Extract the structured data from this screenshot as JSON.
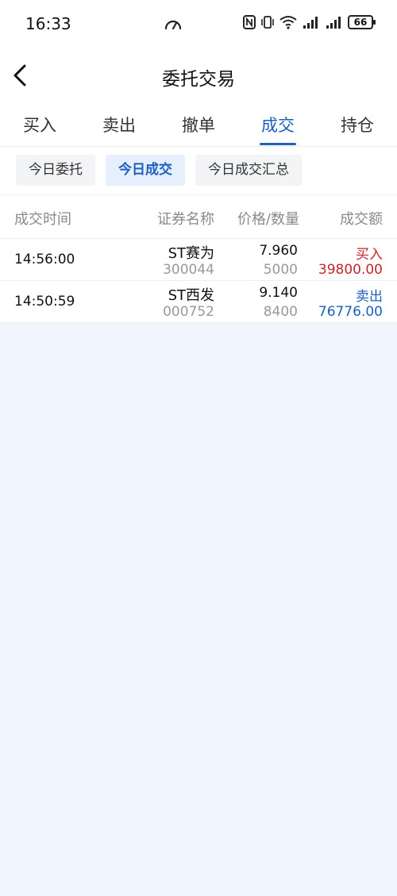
{
  "status_bar": {
    "time": "16:33",
    "battery": "66",
    "icons": [
      "speedometer-icon",
      "nfc-icon",
      "vibrate-icon",
      "wifi-icon",
      "signal-icon",
      "signal-icon"
    ]
  },
  "header": {
    "title": "委托交易"
  },
  "main_tabs": [
    {
      "label": "买入",
      "active": false
    },
    {
      "label": "卖出",
      "active": false
    },
    {
      "label": "撤单",
      "active": false
    },
    {
      "label": "成交",
      "active": true
    },
    {
      "label": "持仓",
      "active": false
    }
  ],
  "sub_tabs": [
    {
      "label": "今日委托",
      "active": false
    },
    {
      "label": "今日成交",
      "active": true
    },
    {
      "label": "今日成交汇总",
      "active": false
    }
  ],
  "table": {
    "headers": {
      "time": "成交时间",
      "name": "证券名称",
      "price_qty": "价格/数量",
      "amount": "成交额"
    },
    "rows": [
      {
        "time": "14:56:00",
        "name": "ST赛为",
        "code": "300044",
        "price": "7.960",
        "qty": "5000",
        "side": "买入",
        "amount": "39800.00"
      },
      {
        "time": "14:50:59",
        "name": "ST西发",
        "code": "000752",
        "price": "9.140",
        "qty": "8400",
        "side": "卖出",
        "amount": "76776.00"
      }
    ]
  },
  "colors": {
    "accent": "#1f5fbf",
    "buy": "#c4262f",
    "sell": "#1f5fbf",
    "background": "#f0f5fe"
  }
}
